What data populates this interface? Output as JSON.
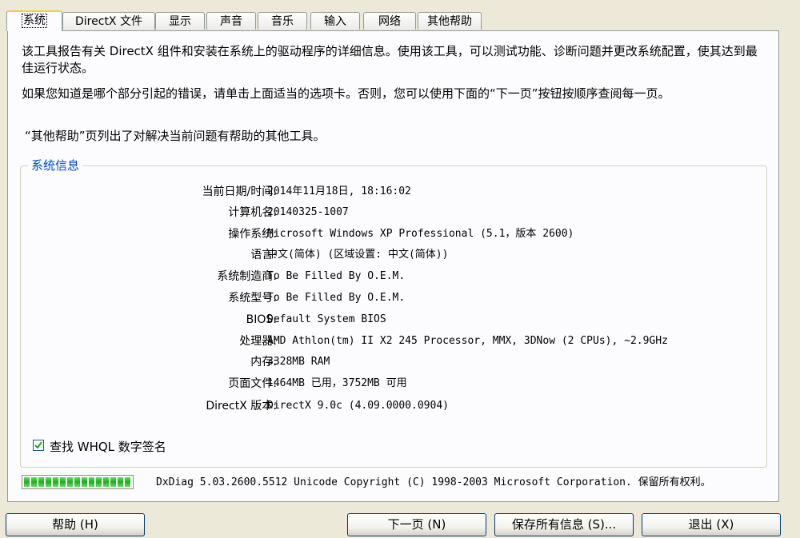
{
  "tabs": [
    {
      "label": "系统",
      "active": true
    },
    {
      "label": "DirectX 文件"
    },
    {
      "label": "显示"
    },
    {
      "label": "声音"
    },
    {
      "label": "音乐"
    },
    {
      "label": "输入"
    },
    {
      "label": "网络"
    },
    {
      "label": "其他帮助"
    }
  ],
  "intro": {
    "para1": "该工具报告有关 DirectX 组件和安装在系统上的驱动程序的详细信息。使用该工具，可以测试功能、诊断问题并更改系统配置，使其达到最佳运行状态。",
    "para2": "如果您知道是哪个部分引起的错误，请单击上面适当的选项卡。否则，您可以使用下面的“下一页”按钮按顺序查阅每一页。",
    "para3": "“其他帮助”页列出了对解决当前问题有帮助的其他工具。"
  },
  "system_info": {
    "title": "系统信息",
    "rows": [
      {
        "label": "当前日期/时间:",
        "value": "2014年11月18日, 18:16:02"
      },
      {
        "label": "计算机名:",
        "value": "20140325-1007"
      },
      {
        "label": "操作系统:",
        "value": "Microsoft Windows XP Professional (5.1，版本 2600)"
      },
      {
        "label": "语言:",
        "value": "中文(简体) (区域设置: 中文(简体))"
      },
      {
        "label": "系统制造商:",
        "value": "To Be Filled By O.E.M."
      },
      {
        "label": "系统型号:",
        "value": "To Be Filled By O.E.M."
      },
      {
        "label": "BIOS:",
        "value": "Default System BIOS"
      },
      {
        "label": "处理器:",
        "value": "AMD Athlon(tm) II X2 245 Processor, MMX, 3DNow (2 CPUs), ~2.9GHz"
      },
      {
        "label": "内存:",
        "value": "3328MB RAM"
      },
      {
        "label": "页面文件:",
        "value": "1464MB 已用，3752MB 可用"
      },
      {
        "label": "DirectX 版本:",
        "value": "DirectX 9.0c (4.09.0000.0904)"
      }
    ]
  },
  "whql": {
    "label": "查找 WHQL 数字签名",
    "checked": true
  },
  "progress": {
    "value": 1.0
  },
  "status": "DxDiag 5.03.2600.5512 Unicode  Copyright (C) 1998-2003 Microsoft Corporation. 保留所有权利。",
  "buttons": {
    "help": "帮助 (H)",
    "next": "下一页 (N)",
    "save": "保存所有信息 (S)...",
    "exit": "退出 (X)"
  },
  "colors": {
    "accent": "#0046d5",
    "tab_highlight": "#ffc83c",
    "progress": "#1faa1f"
  }
}
